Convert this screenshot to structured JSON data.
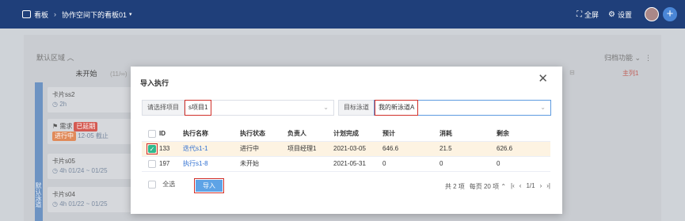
{
  "topbar": {
    "crumb_root": "看板",
    "crumb_board": "协作空间下的看板01",
    "fullscreen_label": "全屏",
    "settings_label": "设置"
  },
  "board": {
    "region_title": "默认区域",
    "region_right": "归档功能",
    "lane_label": "默认泳道",
    "col_title": "未开始",
    "col_count": "11/∞",
    "right_col_label": "主列1",
    "cards": [
      {
        "title": "卡片ss2",
        "meta": "2h"
      },
      {
        "title": "需求",
        "badge": "已延期",
        "status": "进行中",
        "date": "12-05 截止"
      },
      {
        "title": "卡片s05",
        "meta": "4h",
        "range": "01/24 ~ 01/25"
      },
      {
        "title": "卡片s04",
        "meta": "4h",
        "range": "01/22 ~ 01/25"
      }
    ]
  },
  "modal": {
    "title": "导入执行",
    "project_label": "请选择项目",
    "project_value": "s项目1",
    "lane_label": "目标泳道",
    "lane_value": "我的新泳道A",
    "columns": [
      "ID",
      "执行名称",
      "执行状态",
      "负责人",
      "计划完成",
      "预计",
      "消耗",
      "剩余"
    ],
    "rows": [
      {
        "id": "133",
        "name": "迭代s1-1",
        "status": "进行中",
        "owner": "项目经理1",
        "due": "2021-03-05",
        "est": "646.6",
        "used": "21.5",
        "left": "626.6"
      },
      {
        "id": "197",
        "name": "执行s1-8",
        "status": "未开始",
        "owner": "",
        "due": "2021-05-31",
        "est": "0",
        "used": "0",
        "left": "0"
      }
    ],
    "select_all_label": "全选",
    "import_label": "导入",
    "total_text": "共 2 项",
    "per_page_text": "每页 20 项",
    "page_text": "1/1"
  },
  "colors": {
    "topbar": "#1f3f7a",
    "accent": "#2f6fd1",
    "selected_row": "#fdf3e2",
    "check": "#2fb98d",
    "highlight_box": "#d0302a"
  }
}
